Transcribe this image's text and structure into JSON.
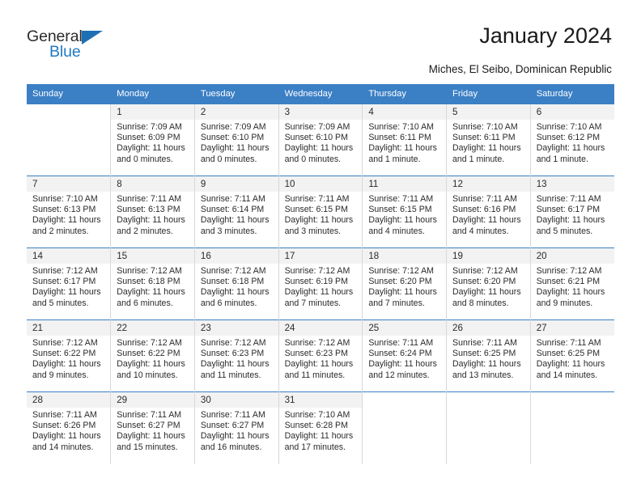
{
  "brand": {
    "name_top": "General",
    "name_bottom": "Blue",
    "triangle_color": "#1f6fb5",
    "blue_color": "#1f7ac4"
  },
  "header": {
    "title": "January 2024",
    "subtitle": "Miches, El Seibo, Dominican Republic"
  },
  "theme": {
    "header_bg": "#3b7fc4",
    "header_text": "#ffffff",
    "daynum_bg": "#f2f2f2",
    "grid_line": "#d8d8d8",
    "row_divider": "#3b7fc4"
  },
  "weekdays": [
    "Sunday",
    "Monday",
    "Tuesday",
    "Wednesday",
    "Thursday",
    "Friday",
    "Saturday"
  ],
  "labels": {
    "sunrise_prefix": "Sunrise:",
    "sunset_prefix": "Sunset:",
    "daylight_prefix": "Daylight:"
  },
  "weeks": [
    [
      {
        "day": "",
        "sunrise": "",
        "sunset": "",
        "daylight": ""
      },
      {
        "day": "1",
        "sunrise": "Sunrise: 7:09 AM",
        "sunset": "Sunset: 6:09 PM",
        "daylight": "Daylight: 11 hours and 0 minutes."
      },
      {
        "day": "2",
        "sunrise": "Sunrise: 7:09 AM",
        "sunset": "Sunset: 6:10 PM",
        "daylight": "Daylight: 11 hours and 0 minutes."
      },
      {
        "day": "3",
        "sunrise": "Sunrise: 7:09 AM",
        "sunset": "Sunset: 6:10 PM",
        "daylight": "Daylight: 11 hours and 0 minutes."
      },
      {
        "day": "4",
        "sunrise": "Sunrise: 7:10 AM",
        "sunset": "Sunset: 6:11 PM",
        "daylight": "Daylight: 11 hours and 1 minute."
      },
      {
        "day": "5",
        "sunrise": "Sunrise: 7:10 AM",
        "sunset": "Sunset: 6:11 PM",
        "daylight": "Daylight: 11 hours and 1 minute."
      },
      {
        "day": "6",
        "sunrise": "Sunrise: 7:10 AM",
        "sunset": "Sunset: 6:12 PM",
        "daylight": "Daylight: 11 hours and 1 minute."
      }
    ],
    [
      {
        "day": "7",
        "sunrise": "Sunrise: 7:10 AM",
        "sunset": "Sunset: 6:13 PM",
        "daylight": "Daylight: 11 hours and 2 minutes."
      },
      {
        "day": "8",
        "sunrise": "Sunrise: 7:11 AM",
        "sunset": "Sunset: 6:13 PM",
        "daylight": "Daylight: 11 hours and 2 minutes."
      },
      {
        "day": "9",
        "sunrise": "Sunrise: 7:11 AM",
        "sunset": "Sunset: 6:14 PM",
        "daylight": "Daylight: 11 hours and 3 minutes."
      },
      {
        "day": "10",
        "sunrise": "Sunrise: 7:11 AM",
        "sunset": "Sunset: 6:15 PM",
        "daylight": "Daylight: 11 hours and 3 minutes."
      },
      {
        "day": "11",
        "sunrise": "Sunrise: 7:11 AM",
        "sunset": "Sunset: 6:15 PM",
        "daylight": "Daylight: 11 hours and 4 minutes."
      },
      {
        "day": "12",
        "sunrise": "Sunrise: 7:11 AM",
        "sunset": "Sunset: 6:16 PM",
        "daylight": "Daylight: 11 hours and 4 minutes."
      },
      {
        "day": "13",
        "sunrise": "Sunrise: 7:11 AM",
        "sunset": "Sunset: 6:17 PM",
        "daylight": "Daylight: 11 hours and 5 minutes."
      }
    ],
    [
      {
        "day": "14",
        "sunrise": "Sunrise: 7:12 AM",
        "sunset": "Sunset: 6:17 PM",
        "daylight": "Daylight: 11 hours and 5 minutes."
      },
      {
        "day": "15",
        "sunrise": "Sunrise: 7:12 AM",
        "sunset": "Sunset: 6:18 PM",
        "daylight": "Daylight: 11 hours and 6 minutes."
      },
      {
        "day": "16",
        "sunrise": "Sunrise: 7:12 AM",
        "sunset": "Sunset: 6:18 PM",
        "daylight": "Daylight: 11 hours and 6 minutes."
      },
      {
        "day": "17",
        "sunrise": "Sunrise: 7:12 AM",
        "sunset": "Sunset: 6:19 PM",
        "daylight": "Daylight: 11 hours and 7 minutes."
      },
      {
        "day": "18",
        "sunrise": "Sunrise: 7:12 AM",
        "sunset": "Sunset: 6:20 PM",
        "daylight": "Daylight: 11 hours and 7 minutes."
      },
      {
        "day": "19",
        "sunrise": "Sunrise: 7:12 AM",
        "sunset": "Sunset: 6:20 PM",
        "daylight": "Daylight: 11 hours and 8 minutes."
      },
      {
        "day": "20",
        "sunrise": "Sunrise: 7:12 AM",
        "sunset": "Sunset: 6:21 PM",
        "daylight": "Daylight: 11 hours and 9 minutes."
      }
    ],
    [
      {
        "day": "21",
        "sunrise": "Sunrise: 7:12 AM",
        "sunset": "Sunset: 6:22 PM",
        "daylight": "Daylight: 11 hours and 9 minutes."
      },
      {
        "day": "22",
        "sunrise": "Sunrise: 7:12 AM",
        "sunset": "Sunset: 6:22 PM",
        "daylight": "Daylight: 11 hours and 10 minutes."
      },
      {
        "day": "23",
        "sunrise": "Sunrise: 7:12 AM",
        "sunset": "Sunset: 6:23 PM",
        "daylight": "Daylight: 11 hours and 11 minutes."
      },
      {
        "day": "24",
        "sunrise": "Sunrise: 7:12 AM",
        "sunset": "Sunset: 6:23 PM",
        "daylight": "Daylight: 11 hours and 11 minutes."
      },
      {
        "day": "25",
        "sunrise": "Sunrise: 7:11 AM",
        "sunset": "Sunset: 6:24 PM",
        "daylight": "Daylight: 11 hours and 12 minutes."
      },
      {
        "day": "26",
        "sunrise": "Sunrise: 7:11 AM",
        "sunset": "Sunset: 6:25 PM",
        "daylight": "Daylight: 11 hours and 13 minutes."
      },
      {
        "day": "27",
        "sunrise": "Sunrise: 7:11 AM",
        "sunset": "Sunset: 6:25 PM",
        "daylight": "Daylight: 11 hours and 14 minutes."
      }
    ],
    [
      {
        "day": "28",
        "sunrise": "Sunrise: 7:11 AM",
        "sunset": "Sunset: 6:26 PM",
        "daylight": "Daylight: 11 hours and 14 minutes."
      },
      {
        "day": "29",
        "sunrise": "Sunrise: 7:11 AM",
        "sunset": "Sunset: 6:27 PM",
        "daylight": "Daylight: 11 hours and 15 minutes."
      },
      {
        "day": "30",
        "sunrise": "Sunrise: 7:11 AM",
        "sunset": "Sunset: 6:27 PM",
        "daylight": "Daylight: 11 hours and 16 minutes."
      },
      {
        "day": "31",
        "sunrise": "Sunrise: 7:10 AM",
        "sunset": "Sunset: 6:28 PM",
        "daylight": "Daylight: 11 hours and 17 minutes."
      },
      {
        "day": "",
        "sunrise": "",
        "sunset": "",
        "daylight": ""
      },
      {
        "day": "",
        "sunrise": "",
        "sunset": "",
        "daylight": ""
      },
      {
        "day": "",
        "sunrise": "",
        "sunset": "",
        "daylight": ""
      }
    ]
  ]
}
